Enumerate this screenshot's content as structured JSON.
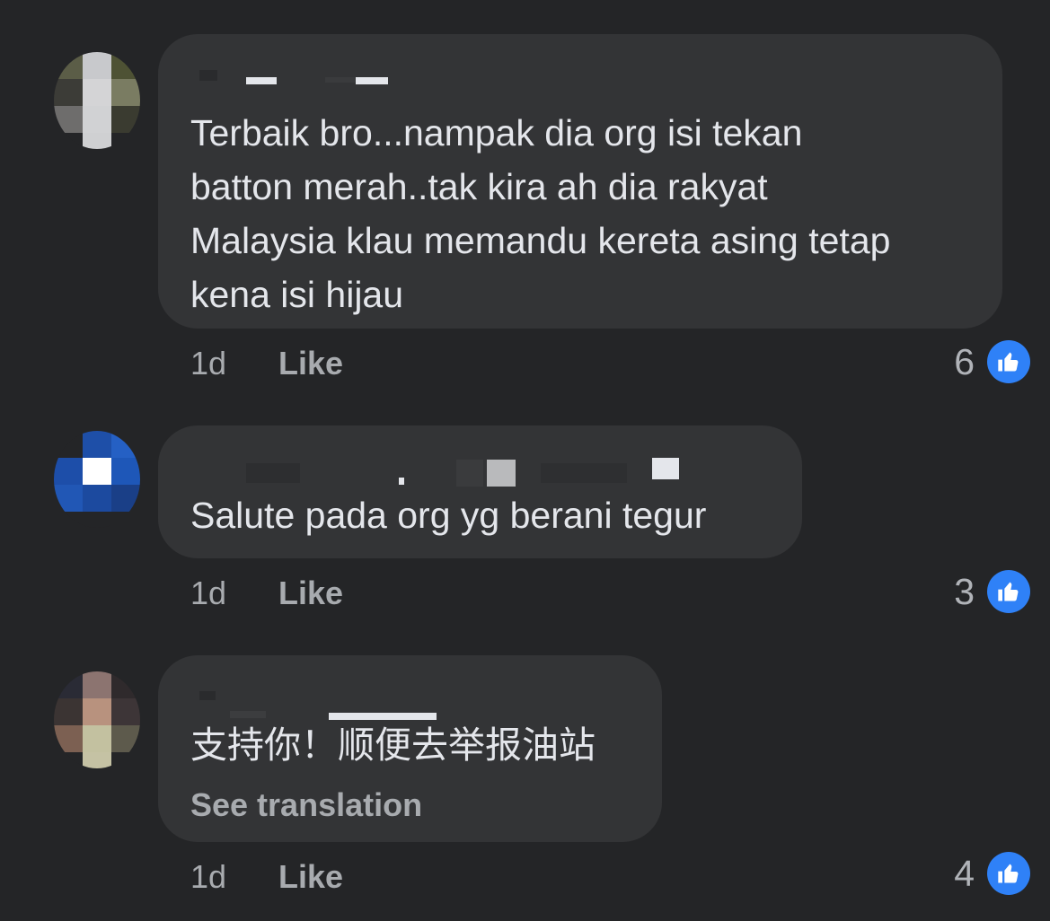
{
  "comments": [
    {
      "text_lines": [
        "Terbaik bro...nampak dia org isi tekan",
        "batton merah..tak kira ah dia rakyat",
        "Malaysia klau memandu kereta asing tetap",
        "kena isi hijau"
      ],
      "time": "1d",
      "like_label": "Like",
      "reaction_count": "6",
      "reaction_icon": "thumbs-up-icon"
    },
    {
      "text_lines": [
        "Salute pada org yg berani tegur"
      ],
      "time": "1d",
      "like_label": "Like",
      "reaction_count": "3",
      "reaction_icon": "thumbs-up-icon"
    },
    {
      "text_lines": [
        "支持你！顺便去举报油站"
      ],
      "see_translation": "See translation",
      "time": "1d",
      "like_label": "Like",
      "reaction_count": "4",
      "reaction_icon": "thumbs-up-icon"
    }
  ],
  "colors": {
    "background": "#242527",
    "bubble": "#333436",
    "text": "#e4e6eb",
    "secondary_text": "#a8abaf",
    "like_blue": "#2f81f7"
  }
}
